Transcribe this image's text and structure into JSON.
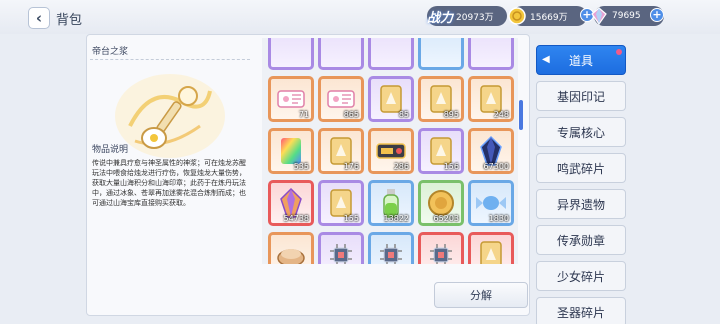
{
  "header": {
    "title": "背包",
    "power_label": "战力",
    "power_value": "20973万",
    "gold_value": "15669万",
    "gem_value": "79695"
  },
  "detail": {
    "item_name": "帝台之浆",
    "desc_heading": "物品说明",
    "desc_text": "传说中兼具疗愈与神圣属性的神浆；可在烛龙苏醒玩法中喂食给烛龙进行疗伤，恢复烛龙大量伤势，获取大量山海积分和山海印章；此药于在炼丹玩法中，通过冰象、苍翠再加迷雾花混合炼制而成；也可通过山海宝库直接购买获取。"
  },
  "grid": {
    "rows": [
      [
        {
          "rarity": "orange",
          "icon": "ticket-icon",
          "count": "71"
        },
        {
          "rarity": "orange",
          "icon": "ticket-icon",
          "count": "865"
        },
        {
          "rarity": "purple",
          "icon": "card-icon",
          "count": "85"
        },
        {
          "rarity": "orange",
          "icon": "card-icon",
          "count": "895"
        },
        {
          "rarity": "orange",
          "icon": "card-icon",
          "count": "248"
        }
      ],
      [
        {
          "rarity": "orange",
          "icon": "rainbow-card-icon",
          "count": "535"
        },
        {
          "rarity": "orange",
          "icon": "card-icon",
          "count": "176"
        },
        {
          "rarity": "orange",
          "icon": "device-icon",
          "count": "286"
        },
        {
          "rarity": "purple",
          "icon": "card-icon",
          "count": "156"
        },
        {
          "rarity": "orange",
          "icon": "dark-crystal-icon",
          "count": "67300"
        }
      ],
      [
        {
          "rarity": "red",
          "icon": "crystal-icon",
          "count": "54738"
        },
        {
          "rarity": "purple",
          "icon": "card-icon",
          "count": "155"
        },
        {
          "rarity": "blue",
          "icon": "potion-icon",
          "count": "13822"
        },
        {
          "rarity": "green",
          "icon": "coin-icon",
          "count": "65203"
        },
        {
          "rarity": "blue",
          "icon": "candy-icon",
          "count": "1830"
        }
      ],
      [
        {
          "rarity": "orange",
          "icon": "food-icon",
          "count": "13065"
        },
        {
          "rarity": "purple",
          "icon": "chip-icon",
          "count": "350"
        },
        {
          "rarity": "blue",
          "icon": "chip-icon",
          "count": "311"
        },
        {
          "rarity": "red",
          "icon": "chip-icon",
          "count": "5"
        },
        {
          "rarity": "red",
          "icon": "card-icon",
          "count": "340"
        }
      ]
    ]
  },
  "decompose_label": "分解",
  "side_menu": [
    {
      "label": "道具",
      "active": true
    },
    {
      "label": "基因印记",
      "active": false
    },
    {
      "label": "专属核心",
      "active": false
    },
    {
      "label": "鸣武碎片",
      "active": false
    },
    {
      "label": "异界遗物",
      "active": false
    },
    {
      "label": "传承勋章",
      "active": false
    },
    {
      "label": "少女碎片",
      "active": false
    },
    {
      "label": "圣器碎片",
      "active": false
    }
  ]
}
